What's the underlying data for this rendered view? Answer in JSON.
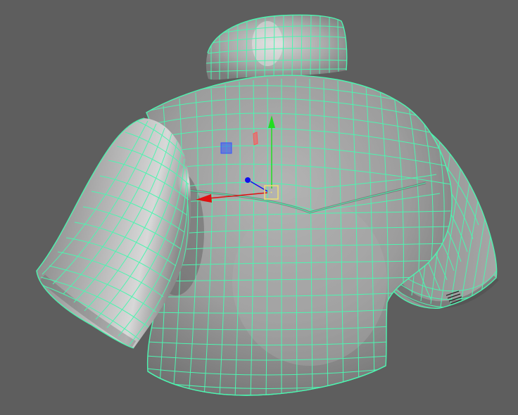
{
  "viewport": {
    "background_color": "#5e5e5e",
    "object": {
      "type": "polygon-mesh-shirt",
      "shading": "smooth-shaded-with-wireframe",
      "selected": true,
      "surface_color": "#9a9a9a",
      "wireframe_color": "#4df5b0"
    },
    "manipulator": {
      "tool": "move-tool",
      "x_axis_color": "#e01010",
      "y_axis_color": "#22dd22",
      "z_axis_color": "#1010ee",
      "center_color": "#f0e070",
      "xy_plane_handle_color": "#3355ff",
      "yz_plane_handle_color": "#ff5555"
    }
  }
}
